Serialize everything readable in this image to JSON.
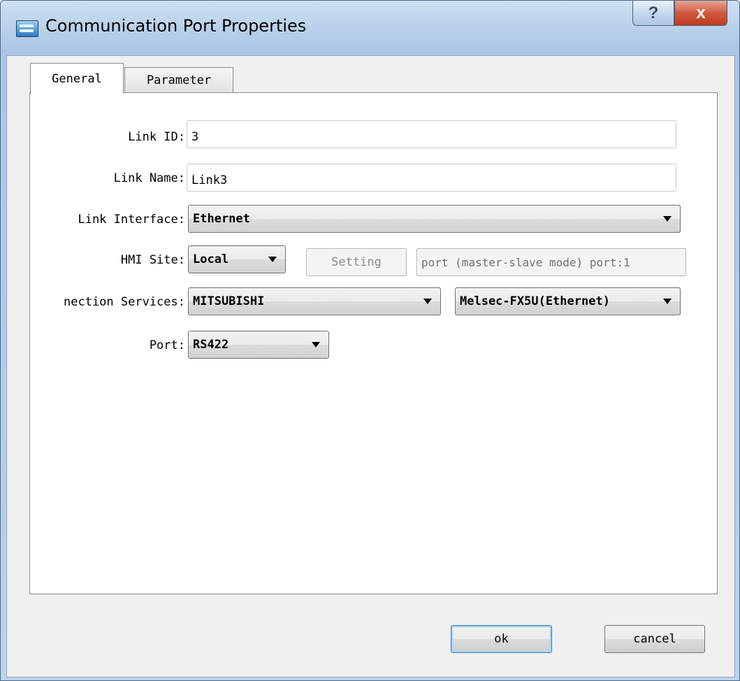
{
  "window": {
    "title": "Communication Port Properties",
    "help_glyph": "?",
    "close_glyph": "x"
  },
  "tabs": [
    {
      "label": "General",
      "selected": true
    },
    {
      "label": "Parameter",
      "selected": false
    }
  ],
  "form": {
    "link_id": {
      "label": "Link ID:",
      "value": "3"
    },
    "link_name": {
      "label": "Link Name:",
      "value": "Link3"
    },
    "link_interface": {
      "label": "Link Interface:",
      "value": "Ethernet"
    },
    "hmi_site": {
      "label": "HMI Site:",
      "value": "Local",
      "setting_label": "Setting",
      "port_info": "port (master-slave mode) port:1"
    },
    "connection_services": {
      "label": "nection Services:",
      "manufacturer": "MITSUBISHI",
      "model": "Melsec-FX5U(Ethernet)"
    },
    "port": {
      "label": "Port:",
      "value": "RS422"
    }
  },
  "footer": {
    "ok_label": "ok",
    "cancel_label": "cancel"
  },
  "icons": {
    "app": "window-app-icon",
    "help": "help-icon",
    "close": "close-icon",
    "dropdown": "chevron-down-icon"
  }
}
